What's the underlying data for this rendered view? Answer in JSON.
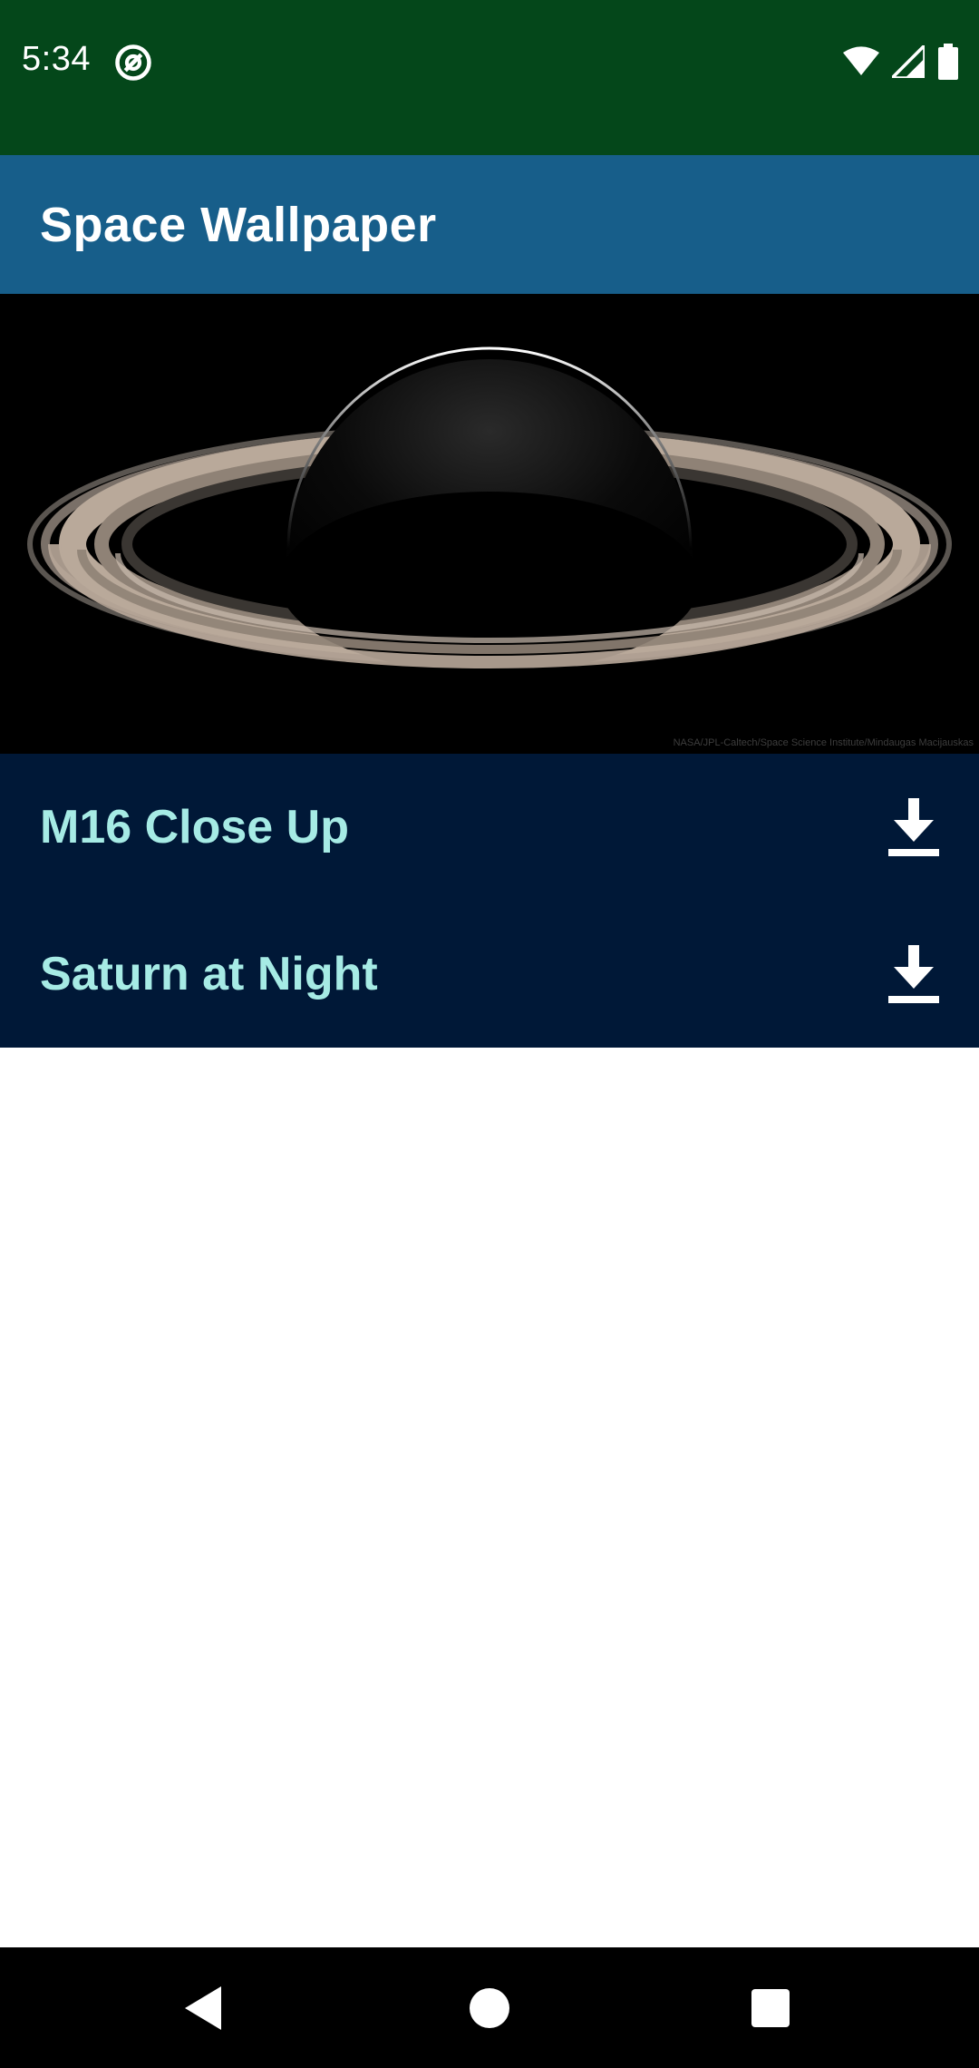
{
  "status_bar": {
    "time": "5:34",
    "icons": [
      "at-sign-icon",
      "wifi-icon",
      "signal-icon",
      "battery-icon"
    ]
  },
  "app_bar": {
    "title": "Space Wallpaper"
  },
  "hero": {
    "image": "saturn-image",
    "credit": "NASA/JPL-Caltech/Space Science Institute/Mindaugas Macijauskas"
  },
  "list": {
    "items": [
      {
        "title": "M16 Close Up",
        "action_icon": "download-icon"
      },
      {
        "title": "Saturn at Night",
        "action_icon": "download-icon"
      }
    ]
  },
  "nav_bar": {
    "buttons": [
      "back-icon",
      "home-icon",
      "recents-icon"
    ]
  },
  "colors": {
    "status_bar": "#04471a",
    "app_bar": "#175e8a",
    "list_background": "#001837",
    "item_text": "#a6ebe5"
  }
}
